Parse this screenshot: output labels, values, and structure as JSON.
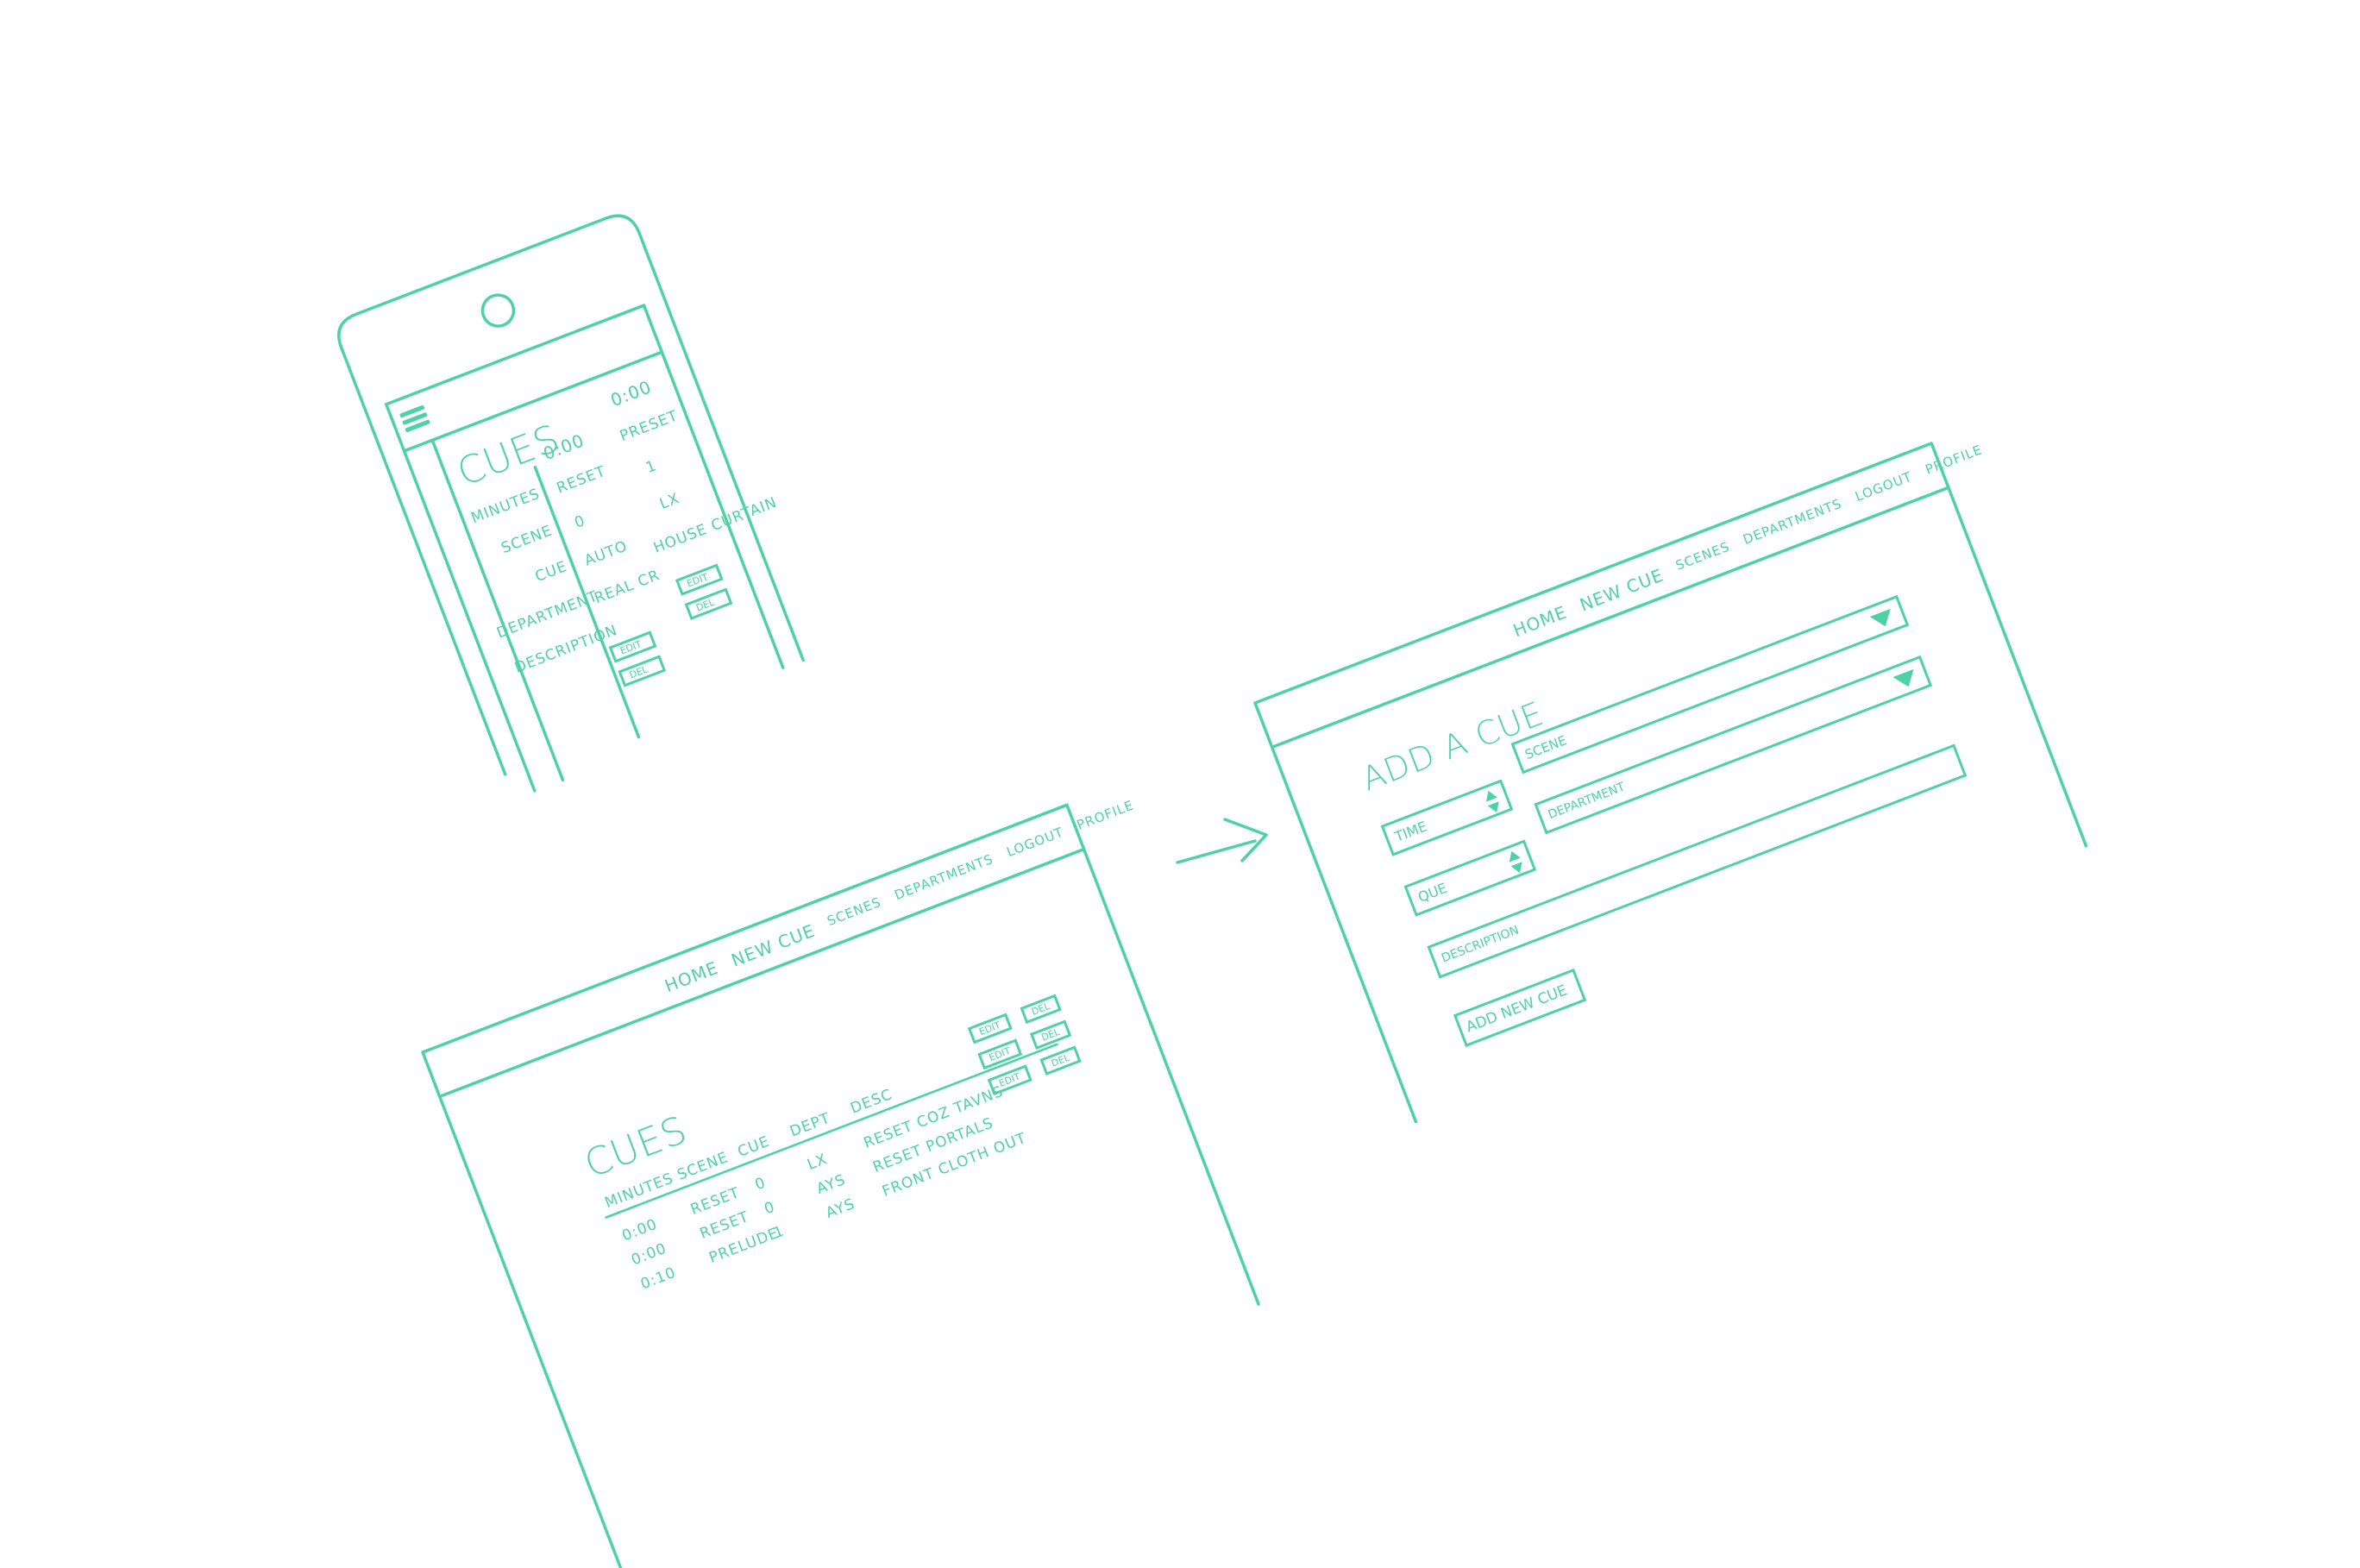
{
  "colors": {
    "ink": "#4fd1a6",
    "paper": "#ffffff"
  },
  "mobile": {
    "menu_icon": "hamburger-icon",
    "title": "CUES",
    "labels": [
      "MINUTES",
      "SCENE",
      "CUE",
      "DEPARTMENT",
      "DESCRIPTION"
    ],
    "col1": [
      "0:00",
      "RESET",
      "0",
      "AUTO",
      "REAL CR"
    ],
    "col2": [
      "0:00",
      "PRESET",
      "1",
      "LX",
      "HOUSE CURTAIN"
    ],
    "edit": "EDIT",
    "del": "DEL"
  },
  "desktop_list": {
    "nav": [
      "HOME",
      "NEW CUE",
      "SCENES",
      "DEPARTMENTS",
      "LOGOUT",
      "PROFILE"
    ],
    "title": "CUES",
    "headers": [
      "MINUTES",
      "SCENE",
      "CUE",
      "DEPT",
      "DESC"
    ],
    "rows": [
      [
        "0:00",
        "RESET",
        "0",
        "LX",
        "RESET COZ TAVNS"
      ],
      [
        "0:00",
        "RESET",
        "0",
        "AYS",
        "RESET PORTALS"
      ],
      [
        "0:10",
        "PRELUDE",
        "1",
        "AYS",
        "FRONT CLOTH OUT"
      ]
    ],
    "edit": "EDIT",
    "del": "DEL"
  },
  "add_cue": {
    "nav": [
      "HOME",
      "NEW CUE",
      "SCENES",
      "DEPARTMENTS",
      "LOGOUT",
      "PROFILE"
    ],
    "title": "ADD A CUE",
    "time_label": "TIME",
    "cue_label": "QUE",
    "scene_label": "SCENE",
    "department_label": "DEPARTMENT",
    "description_label": "DESCRIPTION",
    "submit": "ADD NEW CUE"
  }
}
